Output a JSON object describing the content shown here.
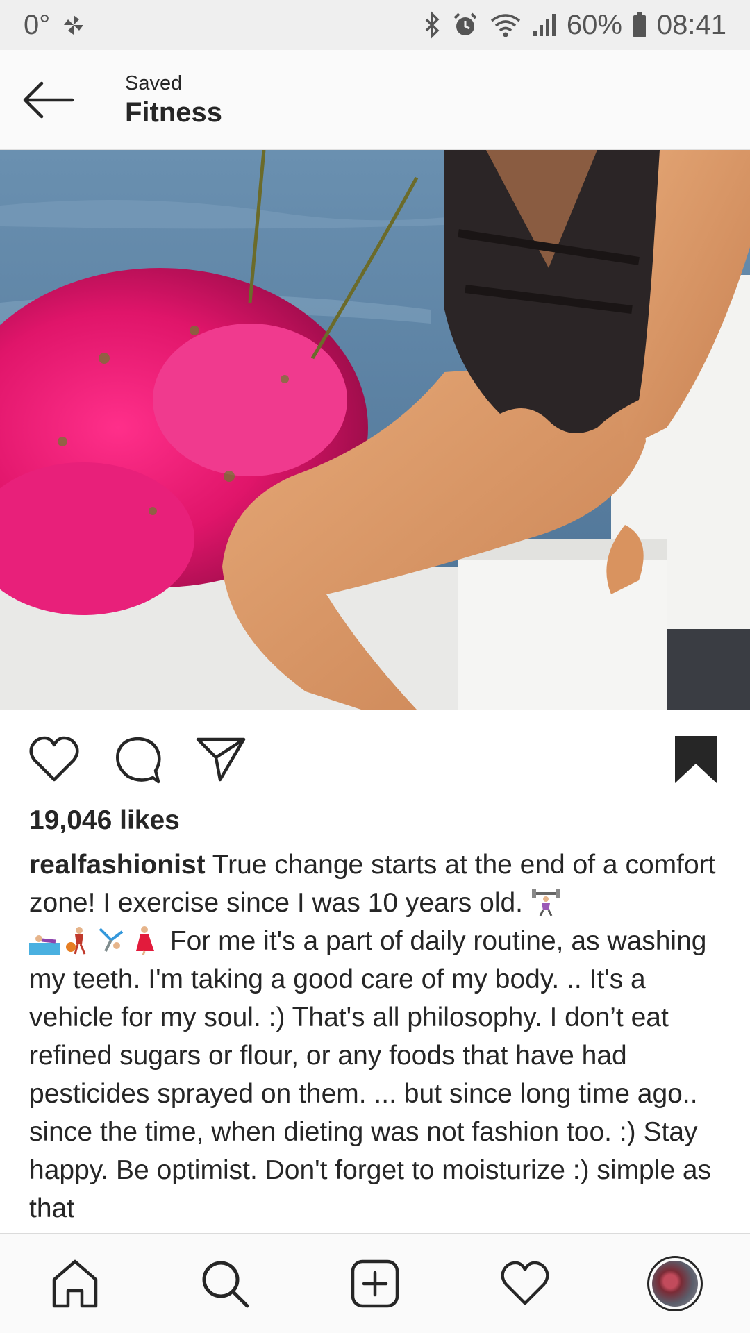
{
  "status_bar": {
    "temperature": "0°",
    "battery": "60%",
    "time": "08:41",
    "icons": [
      "pinwheel-icon",
      "bluetooth-icon",
      "alarm-icon",
      "wifi-icon",
      "signal-icon",
      "battery-icon"
    ]
  },
  "header": {
    "back_icon": "arrow-left-icon",
    "subtitle": "Saved",
    "title": "Fitness"
  },
  "post": {
    "photo_alt": "swimsuit-beach-photo",
    "likes": "19,046 likes",
    "username": "realfashionist",
    "caption_part1": " True change starts  at the end of a comfort zone!  I exercise since I was 10 years old. ",
    "caption_part2": " For me it's a part of daily routine, as washing my teeth. I'm taking a good care of my body. .. It's a vehicle for my soul. :) That's all philosophy. I don’t eat refined sugars or flour, or any foods that have had pesticides sprayed on them. ... but since long time ago.. since the time, when dieting was not fashion too. :) Stay happy. Be optimist.  Don't forget to moisturize :) simple as that",
    "emojis": [
      "weightlifter-emoji",
      "swimmer-emoji",
      "basketball-player-emoji",
      "cartwheel-emoji",
      "dancer-emoji"
    ],
    "actions": [
      "heart-icon",
      "comment-icon",
      "share-icon",
      "bookmark-icon"
    ]
  },
  "bottom_nav": [
    "home-icon",
    "search-icon",
    "add-post-icon",
    "activity-heart-icon",
    "profile-avatar"
  ],
  "colors": {
    "status_bar_bg": "#efefef",
    "header_bg": "#fafafa",
    "text": "#262626"
  }
}
